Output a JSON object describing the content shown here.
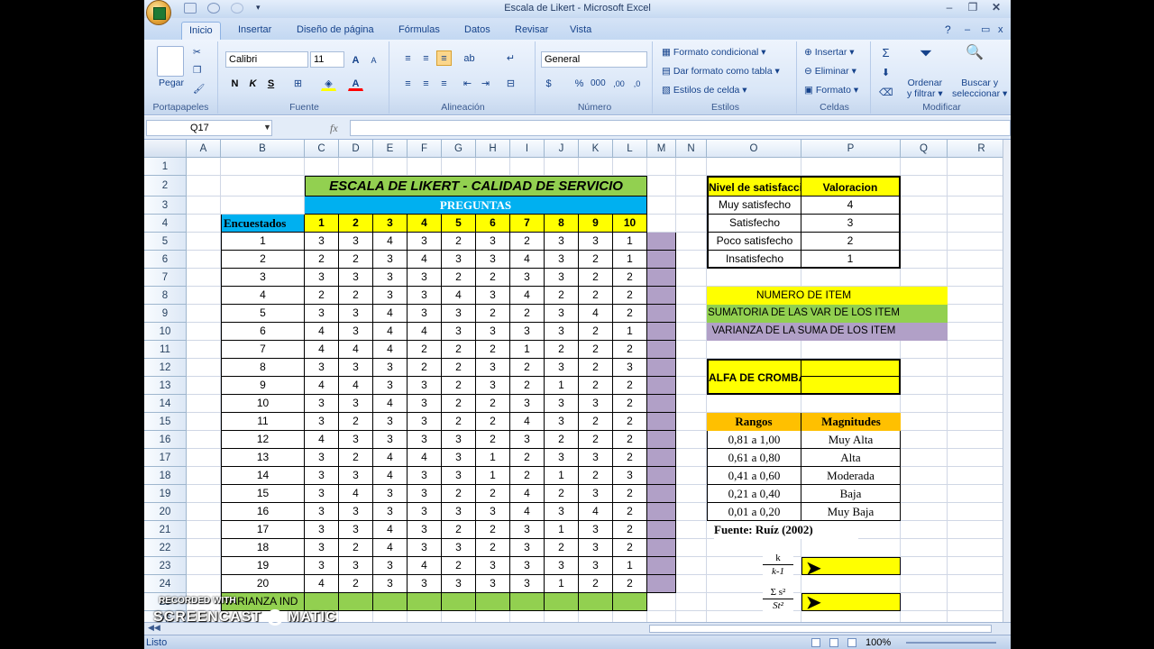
{
  "window": {
    "title": "Escala de Likert - Microsoft Excel"
  },
  "ribbon_tabs": [
    "Inicio",
    "Insertar",
    "Diseño de página",
    "Fórmulas",
    "Datos",
    "Revisar",
    "Vista"
  ],
  "ribbon": {
    "paste": "Pegar",
    "font_name": "Calibri",
    "font_size": "11",
    "number_format": "General",
    "conditional_format": "Formato condicional",
    "format_table": "Dar formato como tabla",
    "cell_styles": "Estilos de celda",
    "insert": "Insertar",
    "delete": "Eliminar",
    "format": "Formato",
    "sort_filter_1": "Ordenar",
    "sort_filter_2": "y filtrar",
    "find_1": "Buscar y",
    "find_2": "seleccionar",
    "groups": [
      "Portapapeles",
      "Fuente",
      "Alineación",
      "Número",
      "Estilos",
      "Celdas",
      "Modificar"
    ]
  },
  "formula_bar": {
    "name_box": "Q17",
    "fx": "fx",
    "content": ""
  },
  "columns": [
    "A",
    "B",
    "C",
    "D",
    "E",
    "F",
    "G",
    "H",
    "I",
    "J",
    "K",
    "L",
    "M",
    "N",
    "O",
    "P",
    "Q",
    "R"
  ],
  "rows": [
    "1",
    "2",
    "3",
    "4",
    "5",
    "6",
    "7",
    "8",
    "9",
    "10",
    "11",
    "12",
    "13",
    "14",
    "15",
    "16",
    "17",
    "18",
    "19",
    "20",
    "21",
    "22",
    "23",
    "24",
    "25",
    "26"
  ],
  "sheet": {
    "title": "ESCALA DE LIKERT - CALIDAD DE SERVICIO",
    "preguntas": "PREGUNTAS",
    "encuestados_header": "Encuestados",
    "question_numbers": [
      "1",
      "2",
      "3",
      "4",
      "5",
      "6",
      "7",
      "8",
      "9",
      "10"
    ],
    "respondents": [
      "1",
      "2",
      "3",
      "4",
      "5",
      "6",
      "7",
      "8",
      "9",
      "10",
      "11",
      "12",
      "13",
      "14",
      "15",
      "16",
      "17",
      "18",
      "19",
      "20"
    ],
    "responses": [
      [
        3,
        3,
        4,
        3,
        2,
        3,
        2,
        3,
        3,
        1
      ],
      [
        2,
        2,
        3,
        4,
        3,
        3,
        4,
        3,
        2,
        1
      ],
      [
        3,
        3,
        3,
        3,
        2,
        2,
        3,
        3,
        2,
        2
      ],
      [
        2,
        2,
        3,
        3,
        4,
        3,
        4,
        2,
        2,
        2
      ],
      [
        3,
        3,
        4,
        3,
        3,
        2,
        2,
        3,
        4,
        2
      ],
      [
        4,
        3,
        4,
        4,
        3,
        3,
        3,
        3,
        2,
        1
      ],
      [
        4,
        4,
        4,
        2,
        2,
        2,
        1,
        2,
        2,
        2
      ],
      [
        3,
        3,
        3,
        2,
        2,
        3,
        2,
        3,
        2,
        3
      ],
      [
        4,
        4,
        3,
        3,
        2,
        3,
        2,
        1,
        2,
        2
      ],
      [
        3,
        3,
        4,
        3,
        2,
        2,
        3,
        3,
        3,
        2
      ],
      [
        3,
        2,
        3,
        3,
        2,
        2,
        4,
        3,
        2,
        2
      ],
      [
        4,
        3,
        3,
        3,
        3,
        2,
        3,
        2,
        2,
        2
      ],
      [
        3,
        2,
        4,
        4,
        3,
        1,
        2,
        3,
        3,
        2
      ],
      [
        3,
        3,
        4,
        3,
        3,
        1,
        2,
        1,
        2,
        3
      ],
      [
        3,
        4,
        3,
        3,
        2,
        2,
        4,
        2,
        3,
        2
      ],
      [
        3,
        3,
        3,
        3,
        3,
        3,
        4,
        3,
        4,
        2
      ],
      [
        3,
        3,
        4,
        3,
        2,
        2,
        3,
        1,
        3,
        2
      ],
      [
        3,
        2,
        4,
        3,
        3,
        2,
        3,
        2,
        3,
        2
      ],
      [
        3,
        3,
        3,
        4,
        2,
        3,
        3,
        3,
        3,
        1
      ],
      [
        4,
        2,
        3,
        3,
        3,
        3,
        3,
        1,
        2,
        2
      ]
    ],
    "varianza_ind": "VARIANZA IND",
    "satisfaccion": {
      "header_nivel": "Nivel de satisfaccion",
      "header_valor": "Valoracion",
      "rows": [
        [
          "Muy satisfecho",
          "4"
        ],
        [
          "Satisfecho",
          "3"
        ],
        [
          "Poco satisfecho",
          "2"
        ],
        [
          "Insatisfecho",
          "1"
        ]
      ]
    },
    "numero_item": "NUMERO DE ITEM",
    "sumatoria": "SUMATORIA DE LAS VAR DE LOS ITEM",
    "varianza_suma": "VARIANZA DE LA SUMA DE LOS ITEM",
    "alfa": "ALFA DE CROMBACH",
    "rangos": {
      "header_rangos": "Rangos",
      "header_magnitudes": "Magnitudes",
      "rows": [
        [
          "0,81 a 1,00",
          "Muy Alta"
        ],
        [
          "0,61 a 0,80",
          "Alta"
        ],
        [
          "0,41 a 0,60",
          "Moderada"
        ],
        [
          "0,21 a 0,40",
          "Baja"
        ],
        [
          "0,01 a 0,20",
          "Muy Baja"
        ]
      ]
    },
    "fuente": "Fuente: Ruíz (2002)",
    "formula1_num": "k",
    "formula1_den": "k-1",
    "formula2_num": "Σ s²",
    "formula2_den": "St²"
  },
  "status": {
    "left": "Listo",
    "zoom": "100%"
  },
  "watermark": {
    "line1": "RECORDED WITH",
    "line2": "SCREENCAST",
    "line3": "MATIC"
  },
  "colors": {
    "green": "#92d050",
    "yellow": "#ffff00",
    "blue": "#00b0f0",
    "purple": "#b1a0c7",
    "orange": "#ffc000",
    "excel_blue": "#15428b"
  }
}
